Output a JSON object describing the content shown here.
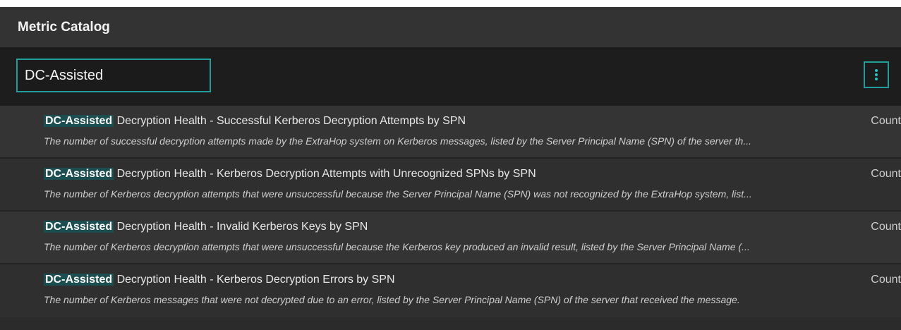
{
  "header": {
    "title": "Metric Catalog"
  },
  "search": {
    "value": "DC-Assisted"
  },
  "menu_button": {
    "icon": "vertical-dots-icon"
  },
  "results": [
    {
      "highlight": "DC-Assisted",
      "title": " Decryption Health - Successful Kerberos Decryption Attempts by SPN",
      "type": "Count",
      "description": "The number of successful decryption attempts made by the ExtraHop system on Kerberos messages, listed by the Server Principal Name (SPN) of the server th..."
    },
    {
      "highlight": "DC-Assisted",
      "title": " Decryption Health - Kerberos Decryption Attempts with Unrecognized SPNs by SPN",
      "type": "Count",
      "description": "The number of Kerberos decryption attempts that were unsuccessful because the Server Principal Name (SPN) was not recognized by the ExtraHop system, list..."
    },
    {
      "highlight": "DC-Assisted",
      "title": " Decryption Health - Invalid Kerberos Keys by SPN",
      "type": "Count",
      "description": "The number of Kerberos decryption attempts that were unsuccessful because the Kerberos key produced an invalid result, listed by the Server Principal Name (..."
    },
    {
      "highlight": "DC-Assisted",
      "title": " Decryption Health - Kerberos Decryption Errors by SPN",
      "type": "Count",
      "description": "The number of Kerberos messages that were not decrypted due to an error, listed by the Server Principal Name (SPN) of the server that received the message."
    }
  ],
  "colors": {
    "accent": "#1f9e9c",
    "highlight_bg": "#1b4e50",
    "panel_bg": "#2b2b2b"
  }
}
